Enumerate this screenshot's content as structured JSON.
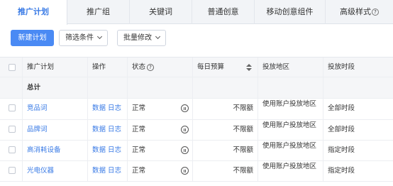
{
  "tabs": [
    {
      "label": "推广计划",
      "active": true
    },
    {
      "label": "推广组"
    },
    {
      "label": "关键词"
    },
    {
      "label": "普通创意"
    },
    {
      "label": "移动创意组件"
    },
    {
      "label": "高级样式",
      "help": "?"
    }
  ],
  "toolbar": {
    "new_plan": "新建计划",
    "filter": "筛选条件",
    "batch_edit": "批量修改"
  },
  "table": {
    "headers": [
      "推广计划",
      "操作",
      "状态",
      "每日预算",
      "投放地区",
      "投放时段"
    ],
    "status_help": "?",
    "total_label": "总计",
    "rows": [
      {
        "plan": "竞品词",
        "op_data": "数据",
        "op_log": "日志",
        "status": "正常",
        "budget": "不限额",
        "region": "使用账户投放地区",
        "period": "全部时段"
      },
      {
        "plan": "品牌词",
        "op_data": "数据",
        "op_log": "日志",
        "status": "正常",
        "budget": "不限额",
        "region": "使用账户投放地区",
        "period": "全部时段"
      },
      {
        "plan": "高消耗设备",
        "op_data": "数据",
        "op_log": "日志",
        "status": "正常",
        "budget": "不限额",
        "region": "使用账户投放地区",
        "period": "指定时段"
      },
      {
        "plan": "光电仪器",
        "op_data": "数据",
        "op_log": "日志",
        "status": "正常",
        "budget": "不限额",
        "region": "使用账户投放地区",
        "period": "指定时段"
      }
    ]
  },
  "colors": {
    "accent": "#3a7be6",
    "primary_button": "#4a8af4",
    "header_bg": "#f5f6f8"
  },
  "icons": {
    "status_pause": "pause-circle-icon",
    "sort": "sort-icon"
  }
}
